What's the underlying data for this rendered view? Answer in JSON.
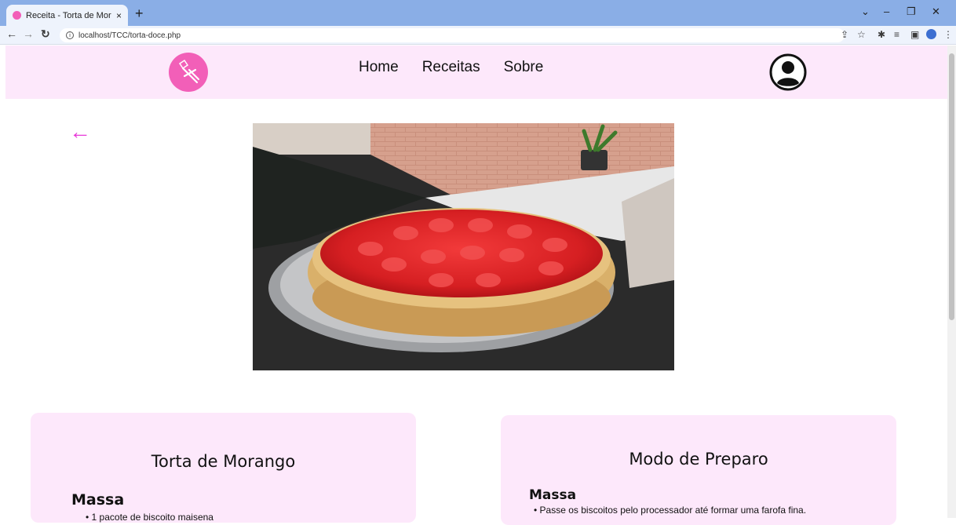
{
  "browser": {
    "tab_title": "Receita - Torta de Morango",
    "tab_close": "×",
    "new_tab": "+",
    "url": "localhost/TCC/torta-doce.php",
    "window": {
      "minimize": "–",
      "maximize": "❐",
      "close": "✕",
      "collapse": "⌄"
    }
  },
  "navbar": {
    "links": [
      "Home",
      "Receitas",
      "Sobre"
    ]
  },
  "colors": {
    "brand_pink": "#f25fb8",
    "accent_magenta": "#e83ad9",
    "card_bg": "#fde8fb"
  },
  "recipe": {
    "back_symbol": "←",
    "ingredients_card": {
      "title": "Torta de Morango",
      "section": "Massa",
      "items": [
        "1 pacote de biscoito maisena"
      ]
    },
    "preparation_card": {
      "title": "Modo de Preparo",
      "section": "Massa",
      "items": [
        "Passe os biscoitos pelo processador até formar uma farofa fina."
      ]
    }
  }
}
